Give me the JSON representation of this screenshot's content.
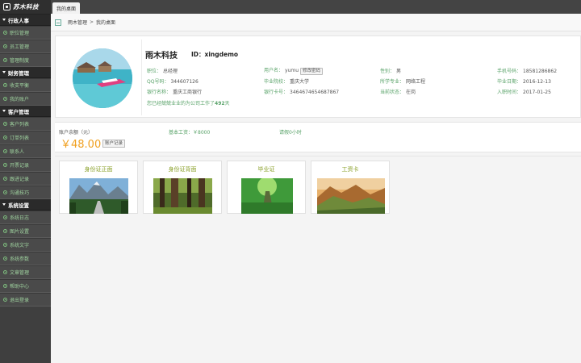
{
  "app": {
    "logo_text": "苏木科技"
  },
  "sidebar": {
    "groups": [
      {
        "title": "行政人事",
        "items": [
          "职位管理",
          "员工管理",
          "管理制度"
        ]
      },
      {
        "title": "财务管理",
        "items": [
          "收支平衡",
          "我的账户"
        ]
      },
      {
        "title": "客户管理",
        "items": [
          "客户列表",
          "订单列表",
          "联系人",
          "开票记录",
          "跟进记录",
          "沟通技巧"
        ]
      },
      {
        "title": "系统设置",
        "items": [
          "系统日志",
          "图片设置",
          "系统文字",
          "系统参数",
          "文章管理",
          "帮助中心",
          "退出登录"
        ]
      }
    ]
  },
  "tabs": [
    {
      "label": "我的桌面"
    }
  ],
  "breadcrumb": {
    "root": "雨木管理",
    "sep": ">",
    "current": "我的桌面"
  },
  "profile": {
    "company": "雨木科技",
    "id_label": "ID：xingdemo",
    "position": {
      "k": "职位：",
      "v": "总经理"
    },
    "qq": {
      "k": "QQ号码：",
      "v": "344607126"
    },
    "bank": {
      "k": "银行名称：",
      "v": "重庆工商银行"
    },
    "username": {
      "k": "用户名：",
      "v": "yumu",
      "btn": "修改密码"
    },
    "school": {
      "k": "毕业院校：",
      "v": "重庆大学"
    },
    "card": {
      "k": "银行卡号：",
      "v": "3464674654687867"
    },
    "gender": {
      "k": "性别：",
      "v": "男"
    },
    "major": {
      "k": "所学专业：",
      "v": "网络工程"
    },
    "status": {
      "k": "当前状态：",
      "v": "在岗"
    },
    "phone": {
      "k": "手机号码：",
      "v": "18581286862"
    },
    "grad_date": {
      "k": "毕业日期：",
      "v": "2016-12-13"
    },
    "join_date": {
      "k": "入职时间：",
      "v": "2017-01-25"
    },
    "worked_prefix": "您已经兢兢业业的为公司工作了",
    "worked_days": "492",
    "worked_suffix": "天"
  },
  "account": {
    "balance_label": "账户余额（元）",
    "balance_value": "￥48.00",
    "record_btn": "账户记录",
    "salary": "基本工资：￥8000",
    "leave": "请假0小时"
  },
  "documents": [
    {
      "title": "身份证正面"
    },
    {
      "title": "身份证背面"
    },
    {
      "title": "毕业证"
    },
    {
      "title": "工资卡"
    }
  ],
  "colors": {
    "sidebar_bg": "#3f3f3f",
    "accent_green": "#5aa36a",
    "balance_orange": "#f0a020"
  }
}
